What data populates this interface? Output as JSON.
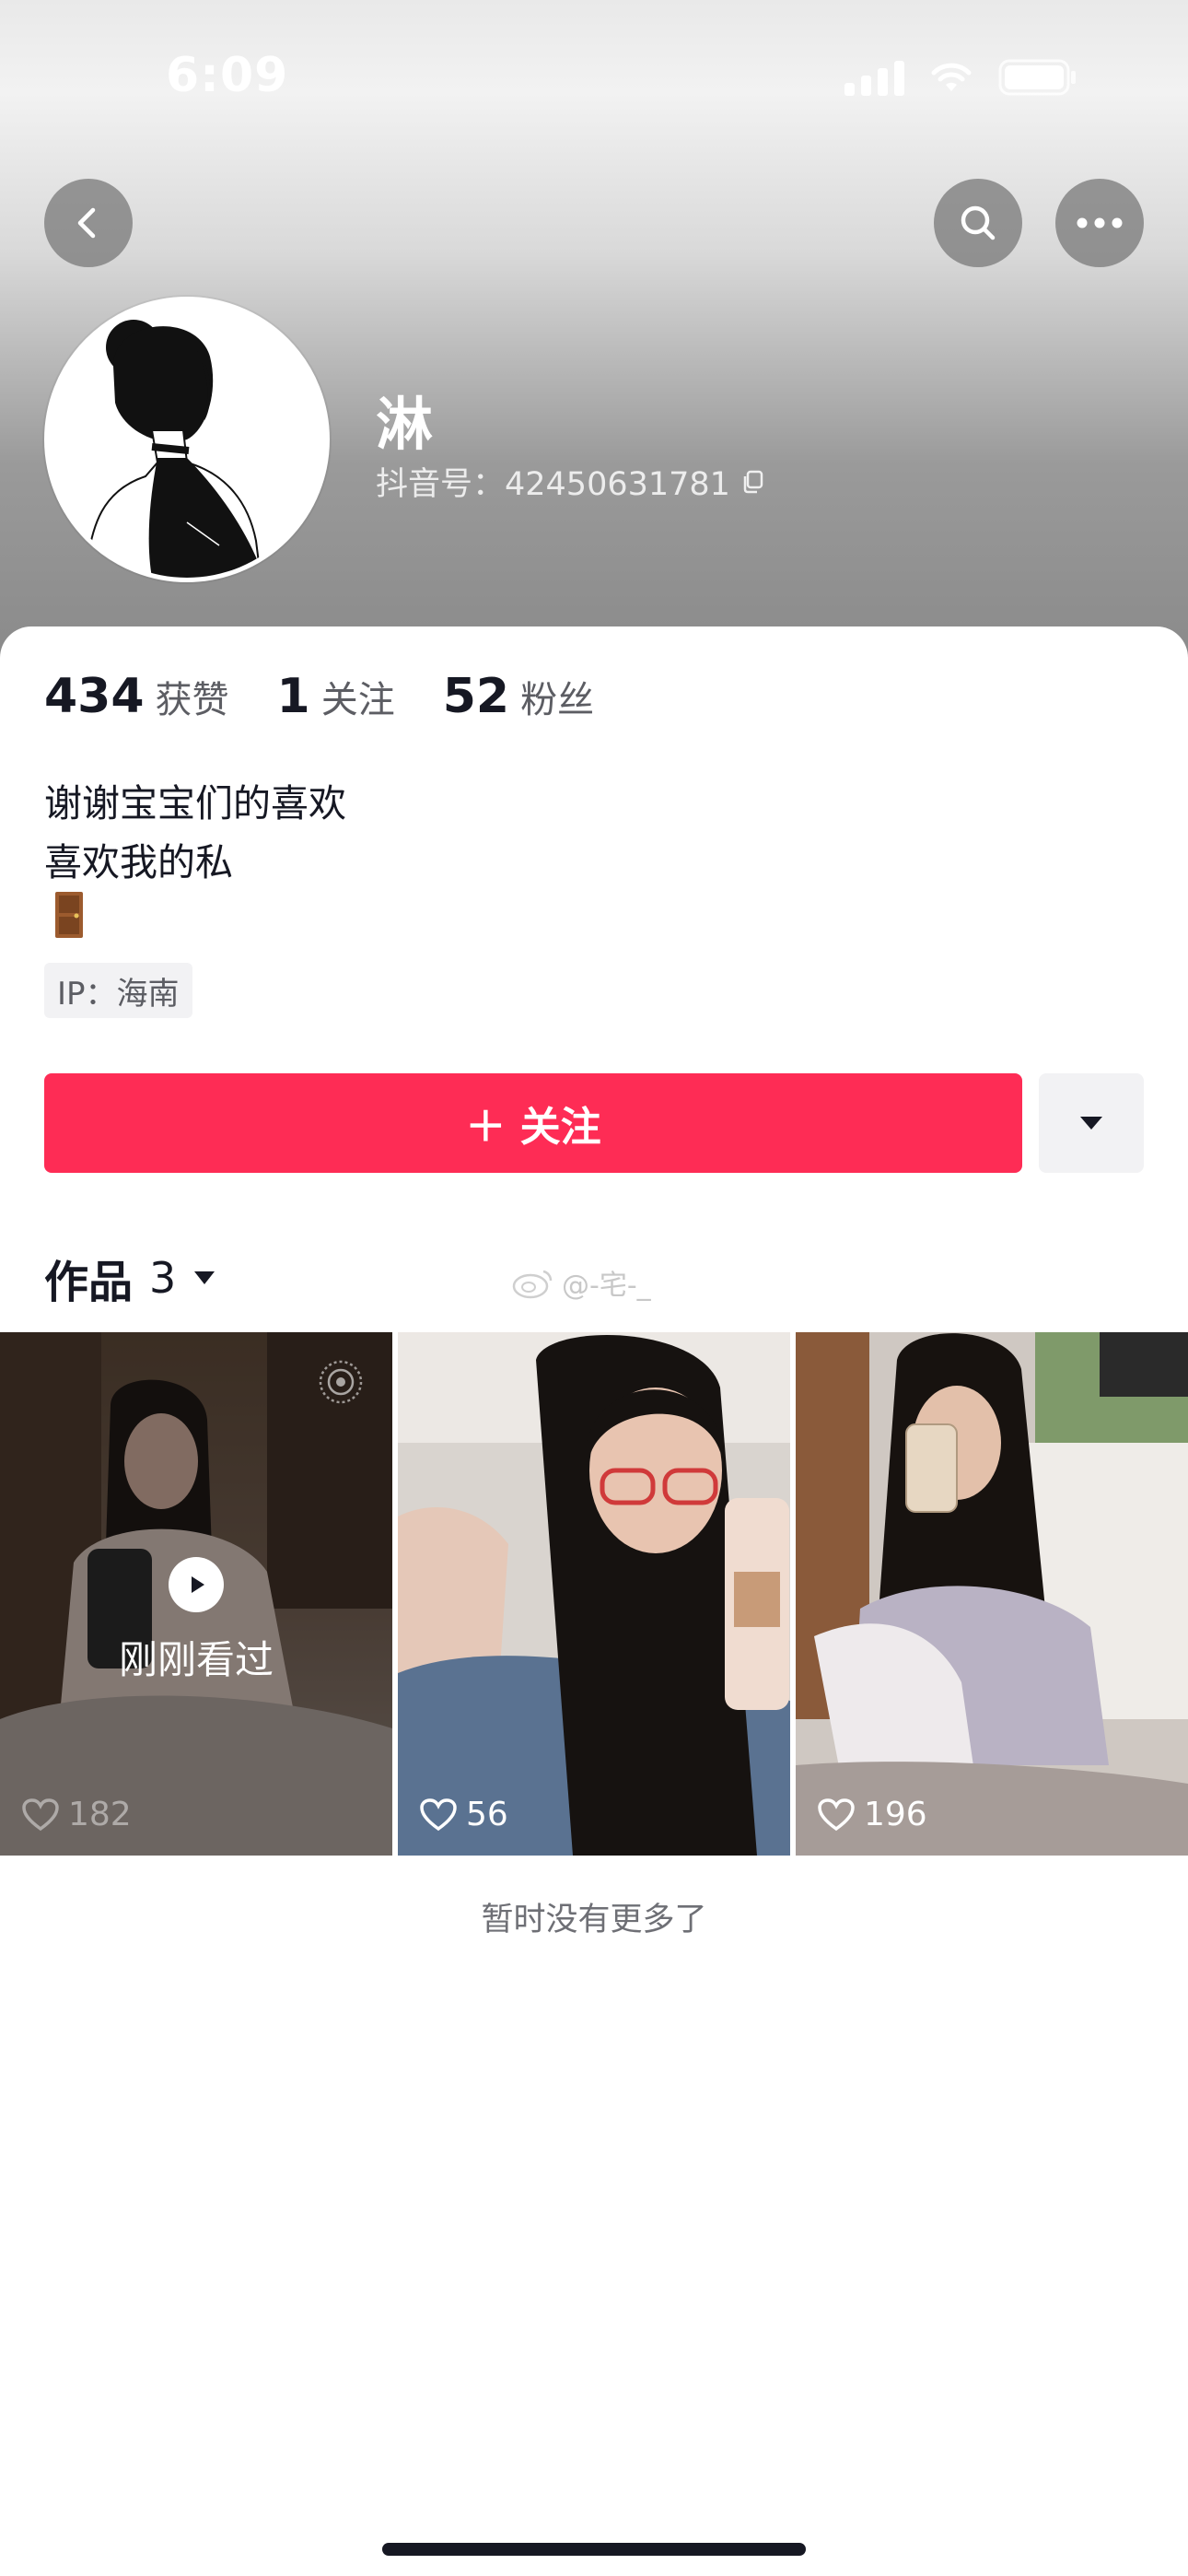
{
  "status_bar": {
    "time": "6:09"
  },
  "profile": {
    "nickname": "淋",
    "douyin_id": "抖音号：42450631781"
  },
  "stats": [
    {
      "value": "434",
      "label": "获赞"
    },
    {
      "value": "1",
      "label": "关注"
    },
    {
      "value": "52",
      "label": "粉丝"
    }
  ],
  "bio": {
    "line1": "谢谢宝宝们的喜欢",
    "line2": "喜欢我的私",
    "emoji_icon": "door-icon"
  },
  "ip_tag": "IP：海南",
  "actions": {
    "follow_label": "＋ 关注"
  },
  "works": {
    "label": "作品",
    "count": "3",
    "watermark": "@-宅-_"
  },
  "videos": [
    {
      "likes": "182",
      "watched_label": "刚刚看过"
    },
    {
      "likes": "56"
    },
    {
      "likes": "196"
    }
  ],
  "footer": {
    "no_more": "暂时没有更多了"
  },
  "colors": {
    "accent": "#fe2c55",
    "text": "#161823",
    "secondary": "#5c5d63"
  }
}
